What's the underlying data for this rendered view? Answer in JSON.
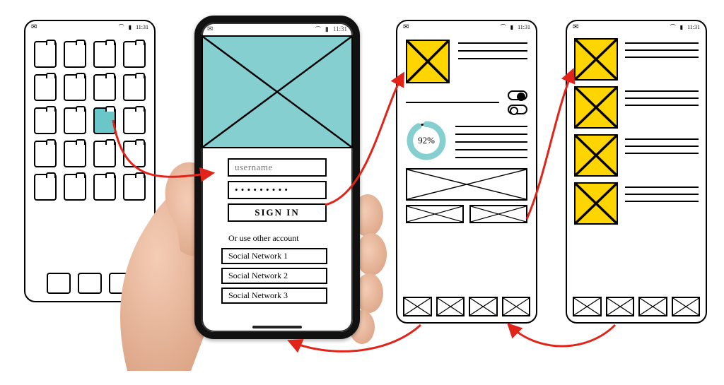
{
  "status": {
    "time": "11:31",
    "icons": [
      "mail",
      "wifi",
      "signal"
    ]
  },
  "screen1": {
    "rows": 5,
    "cols": 4,
    "selected_index": 10,
    "dock_count": 3
  },
  "screen2": {
    "username_placeholder": "username",
    "password_masked": "• • • • • • • • •",
    "signin_label": "SIGN IN",
    "or_text": "Or use other account",
    "social": [
      "Social Network 1",
      "Social Network 2",
      "Social Network 3"
    ]
  },
  "screen3": {
    "progress_pct": 92,
    "progress_label": "92%",
    "toggles": [
      "on",
      "off"
    ],
    "top_text_lines": 3,
    "mid_text_lines": 5,
    "tabbar_count": 4
  },
  "screen4": {
    "items": [
      {
        "lines": 3
      },
      {
        "lines": 3
      },
      {
        "lines": 3
      },
      {
        "lines": 3
      }
    ],
    "tabbar_count": 4
  },
  "colors": {
    "accent_teal": "#85cfd1",
    "accent_yellow": "#ffd500",
    "arrow": "#e2231a"
  },
  "flow_arrows": [
    [
      "screen1.selected_app",
      "screen2.username"
    ],
    [
      "screen2.signin",
      "screen3.top"
    ],
    [
      "screen3.thumbnail",
      "screen4.list"
    ],
    [
      "screen4.tabbar",
      "screen3.tabbar"
    ],
    [
      "screen3.tabbar",
      "screen2.home"
    ]
  ]
}
